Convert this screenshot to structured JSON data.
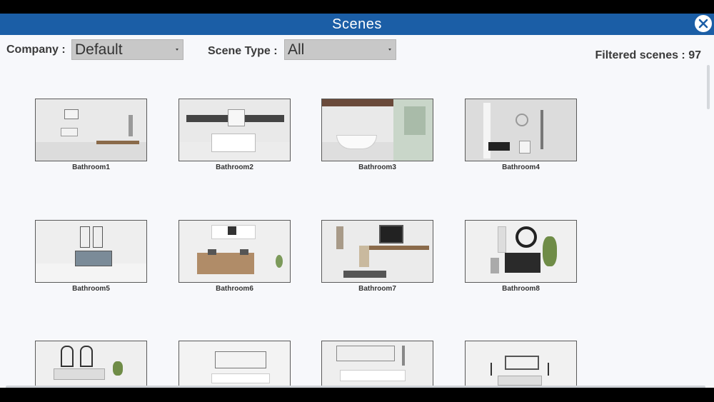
{
  "dialog": {
    "title": "Scenes"
  },
  "filters": {
    "company_label": "Company :",
    "company_value": "Default",
    "scene_type_label": "Scene Type :",
    "scene_type_value": "All"
  },
  "filtered": {
    "text": "Filtered scenes : 97"
  },
  "scenes": [
    {
      "name": "Bathroom1"
    },
    {
      "name": "Bathroom2"
    },
    {
      "name": "Bathroom3"
    },
    {
      "name": "Bathroom4"
    },
    {
      "name": "Bathroom5"
    },
    {
      "name": "Bathroom6"
    },
    {
      "name": "Bathroom7"
    },
    {
      "name": "Bathroom8"
    },
    {
      "name": ""
    },
    {
      "name": ""
    },
    {
      "name": ""
    },
    {
      "name": ""
    }
  ],
  "colors": {
    "titlebar": "#1b5ea6",
    "panel": "#f7f8fb",
    "select": "#c8c8c8"
  }
}
